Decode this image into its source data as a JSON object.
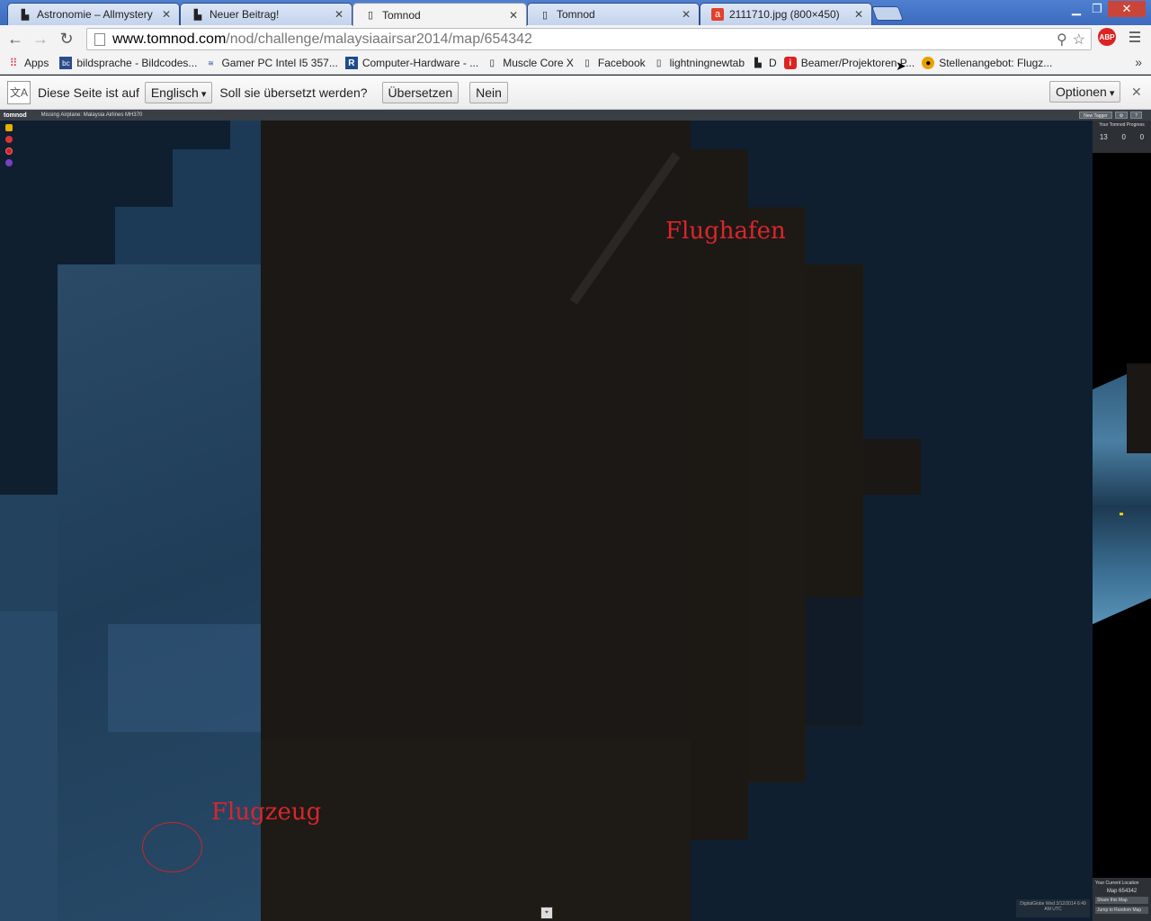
{
  "browser": {
    "tabs": [
      {
        "title": "Astronomie – Allmystery",
        "icon": "allmystery-icon"
      },
      {
        "title": "Neuer Beitrag!",
        "icon": "allmystery-icon"
      },
      {
        "title": "Tomnod",
        "icon": "page-icon",
        "active": true
      },
      {
        "title": "Tomnod",
        "icon": "page-icon"
      },
      {
        "title": "2111710.jpg (800×450)",
        "icon": "image-icon"
      }
    ],
    "tab_close": "✕",
    "address": {
      "host": "www.tomnod.com",
      "path": "/nod/challenge/malaysiaairsar2014/map/654342"
    },
    "abp_label": "ABP",
    "bookmarks": [
      {
        "label": "Apps",
        "icon": "apps-grid-icon"
      },
      {
        "label": "bildsprache - Bildcodes...",
        "icon": "bc-icon"
      },
      {
        "label": "Gamer PC Intel I5 357...",
        "icon": "alternate-icon"
      },
      {
        "label": "Computer-Hardware - ...",
        "icon": "r-icon"
      },
      {
        "label": "Muscle Core X",
        "icon": "page-icon"
      },
      {
        "label": "Facebook",
        "icon": "page-icon"
      },
      {
        "label": "lightningnewtab",
        "icon": "page-icon"
      },
      {
        "label": "D",
        "icon": "allmystery-icon"
      },
      {
        "label": "Beamer/Projektoren P...",
        "icon": "i-icon"
      },
      {
        "label": "Stellenangebot: Flugz...",
        "icon": "circle-icon"
      }
    ],
    "bookmarks_more": "»"
  },
  "translate_bar": {
    "text_before": "Diese Seite ist auf",
    "language": "Englisch",
    "question": "Soll sie übersetzt werden?",
    "translate_button": "Übersetzen",
    "no_button": "Nein",
    "options_button": "Optionen",
    "close": "✕"
  },
  "tomnod": {
    "logo": "tomnod",
    "mission": "Missing Airplane: Malaysia Airlines MH370",
    "new_tagger": "New Tagger",
    "progress_title": "Your Tomnod Progress",
    "stats": [
      "13",
      "0",
      "0"
    ],
    "current_location_label": "Your Current Location",
    "current_location_value": "Map 654342",
    "share_button": "Share this Map",
    "random_button": "Jump to Random Map",
    "credit": "DigitalGlobe  Wed 3/12/2014 6:49 AM UTC"
  },
  "annotations": {
    "airport": "Flughafen",
    "plane": "Flugzeug"
  },
  "colors": {
    "annotation": "#d8262c",
    "water": "#0f1f30",
    "land": "#1a1714"
  }
}
